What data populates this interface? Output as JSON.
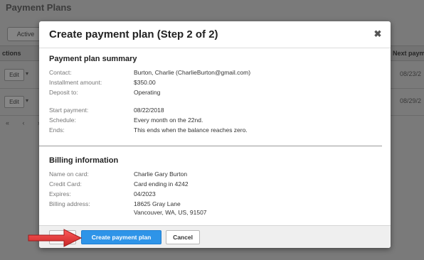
{
  "background": {
    "page_title": "Payment Plans",
    "active_tab": "Active",
    "column_left": "ctions",
    "column_right": "Next paym",
    "rows": [
      {
        "edit_label": "Edit",
        "next_payment": "08/23/2"
      },
      {
        "edit_label": "Edit",
        "next_payment": "08/29/2"
      }
    ],
    "pager": "« ‹ ›"
  },
  "modal": {
    "title": "Create payment plan (Step 2 of 2)",
    "close_glyph": "✖",
    "summary": {
      "heading": "Payment plan summary",
      "rows": [
        {
          "label": "Contact:",
          "value": "Burton, Charlie (CharlieBurton@gmail.com)"
        },
        {
          "label": "Installment amount:",
          "value": "$350.00"
        },
        {
          "label": "Deposit to:",
          "value": "Operating"
        },
        {
          "label": "Start payment:",
          "value": "08/22/2018"
        },
        {
          "label": "Schedule:",
          "value": "Every month on the 22nd."
        },
        {
          "label": "Ends:",
          "value": "This ends when the balance reaches zero."
        }
      ]
    },
    "billing": {
      "heading": "Billing information",
      "rows": [
        {
          "label": "Name on card:",
          "value": "Charlie Gary Burton"
        },
        {
          "label": "Credit Card:",
          "value": "Card ending in 4242"
        },
        {
          "label": "Expires:",
          "value": "04/2023"
        },
        {
          "label": "Billing address:",
          "value": "18625 Gray Lane",
          "value2": "Vancouver, WA, US, 91507"
        }
      ]
    },
    "footer": {
      "create_label": "Create payment plan",
      "cancel_label": "Cancel"
    }
  },
  "colors": {
    "primary": "#2e94e8",
    "arrow": "#e03a3a"
  },
  "icons": {
    "close": "close-icon",
    "arrow": "red-arrow-icon"
  }
}
